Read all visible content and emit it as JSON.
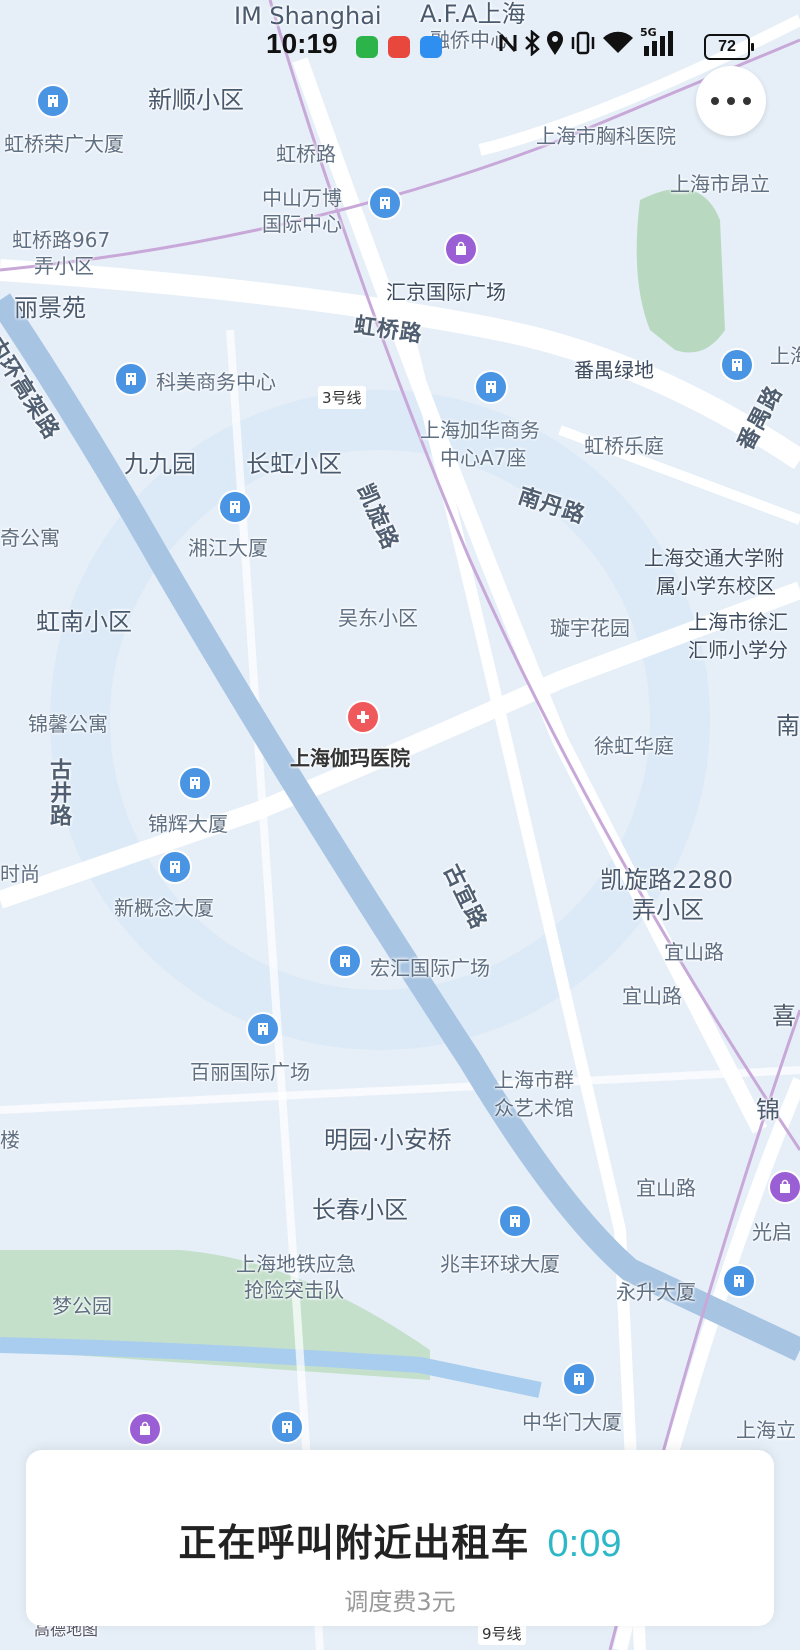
{
  "status_bar": {
    "time": "10:19",
    "battery": "72",
    "network": "5G",
    "app_icons": [
      "green-shield-app-icon",
      "red-app-icon",
      "blue-chat-app-icon"
    ],
    "sys_icons": [
      "nfc-icon",
      "bluetooth-icon",
      "location-icon",
      "vibrate-icon",
      "wifi-icon",
      "signal-icon"
    ]
  },
  "more_button": {
    "icon": "more-dots-icon"
  },
  "map": {
    "labels": {
      "im_shanghai": "IM Shanghai",
      "afa": "A.F.A上海",
      "ronqiao": "融侨中心",
      "xinshun": "新顺小区",
      "hongqiao_rongguang": "虹桥荣广大厦",
      "hongqiao_road_1": "虹桥路",
      "xiongke": "上海市胸科医院",
      "anli": "上海市昂立",
      "zhongshan": "中山万博",
      "zhongshan2": "国际中心",
      "hongqiao967": "虹桥路967",
      "hongqiao967b": "弄小区",
      "huijing": "汇京国际广场",
      "lijingyuan": "丽景苑",
      "neihuan": "内环高架路",
      "hongqiao_road_2": "虹桥路",
      "panyu_green": "番禺绿地",
      "kemei": "科美商务中心",
      "line3": "3号线",
      "jiahua": "上海加华商务",
      "jiahua2": "中心A7座",
      "hongqiao_leting": "虹桥乐庭",
      "jiujiu": "九九园",
      "changhong": "长虹小区",
      "kaixuan_road": "凯旋路",
      "nandan_road": "南丹路",
      "panyu_road": "番禺路",
      "xiangjiang": "湘江大厦",
      "jiaoda1": "上海交通大学附",
      "jiaoda2": "属小学东校区",
      "qi_gongyu": "奇公寓",
      "hongnan": "虹南小区",
      "wudong": "吴东小区",
      "xuanyu": "璇宇花园",
      "xuhui1": "上海市徐汇",
      "xuhui2": "汇师小学分",
      "jinxin": "锦馨公寓",
      "gama": "上海伽玛医院",
      "xuhong": "徐虹华庭",
      "gujing_road": "古井路",
      "jinhui": "锦辉大厦",
      "shishang": "时尚",
      "xingainian": "新概念大厦",
      "guyi_road": "古宜路",
      "kaixuan2280": "凯旋路2280",
      "kaixuan2280b": "弄小区",
      "yishan_road_1": "宜山路",
      "yishan_road_2": "宜山路",
      "honghui": "宏汇国际广场",
      "baili": "百丽国际广场",
      "qunzhong1": "上海市群",
      "qunzhong2": "众艺术馆",
      "lou": "楼",
      "mingyuan": "明园·小安桥",
      "yishan_road_3": "宜山路",
      "guangqi": "光启",
      "changchun": "长春小区",
      "zhaofeng": "兆丰环球大厦",
      "metro_rescue1": "上海地铁应急",
      "metro_rescue2": "抢险突击队",
      "menggongyuan": "梦公园",
      "yongsheng": "永升大厦",
      "zhonghuamen": "中华门大厦",
      "line9": "9号线",
      "gaode": "高德地图",
      "xi_jia": "喜",
      "jin": "锦",
      "nan": "南",
      "shanghai_r": "上海",
      "shanghai_li": "上海立"
    }
  },
  "card": {
    "title": "正在呼叫附近出租车",
    "timer": "0:09",
    "fee": "调度费3元"
  }
}
